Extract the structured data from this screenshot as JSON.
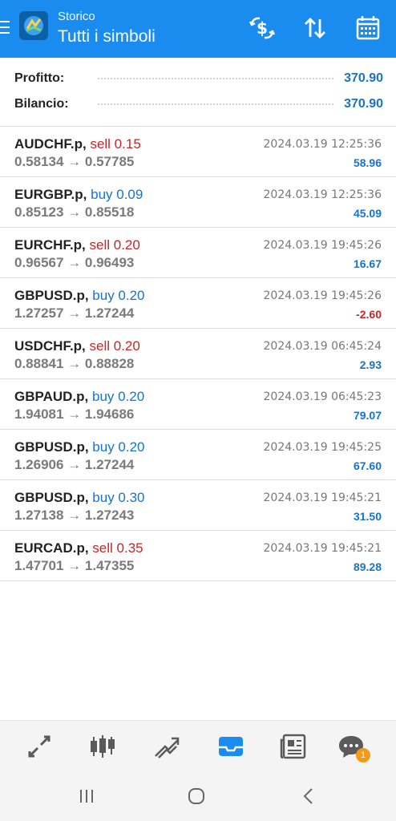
{
  "header": {
    "subtitle": "Storico",
    "title": "Tutti i simboli",
    "icons": [
      "menu-icon",
      "app-logo",
      "dollar-exchange-icon",
      "sort-icon",
      "calendar-icon"
    ]
  },
  "summary": {
    "profit_label": "Profitto:",
    "profit_value": "370.90",
    "balance_label": "Bilancio:",
    "balance_value": "370.90"
  },
  "trades": [
    {
      "symbol": "AUDCHF.p,",
      "side": "sell 0.15",
      "type": "sell",
      "prices": "0.58134 → 0.57785",
      "time": "2024.03.19 12:25:36",
      "profit": "58.96",
      "sign": "pos"
    },
    {
      "symbol": "EURGBP.p,",
      "side": "buy 0.09",
      "type": "buy",
      "prices": "0.85123 → 0.85518",
      "time": "2024.03.19 12:25:36",
      "profit": "45.09",
      "sign": "pos"
    },
    {
      "symbol": "EURCHF.p,",
      "side": "sell 0.20",
      "type": "sell",
      "prices": "0.96567 → 0.96493",
      "time": "2024.03.19 19:45:26",
      "profit": "16.67",
      "sign": "pos"
    },
    {
      "symbol": "GBPUSD.p,",
      "side": "buy 0.20",
      "type": "buy",
      "prices": "1.27257 → 1.27244",
      "time": "2024.03.19 19:45:26",
      "profit": "-2.60",
      "sign": "neg"
    },
    {
      "symbol": "USDCHF.p,",
      "side": "sell 0.20",
      "type": "sell",
      "prices": "0.88841 → 0.88828",
      "time": "2024.03.19 06:45:24",
      "profit": "2.93",
      "sign": "pos"
    },
    {
      "symbol": "GBPAUD.p,",
      "side": "buy 0.20",
      "type": "buy",
      "prices": "1.94081 → 1.94686",
      "time": "2024.03.19 06:45:23",
      "profit": "79.07",
      "sign": "pos"
    },
    {
      "symbol": "GBPUSD.p,",
      "side": "buy 0.20",
      "type": "buy",
      "prices": "1.26906 → 1.27244",
      "time": "2024.03.19 19:45:25",
      "profit": "67.60",
      "sign": "pos"
    },
    {
      "symbol": "GBPUSD.p,",
      "side": "buy 0.30",
      "type": "buy",
      "prices": "1.27138 → 1.27243",
      "time": "2024.03.19 19:45:21",
      "profit": "31.50",
      "sign": "pos"
    },
    {
      "symbol": "EURCAD.p,",
      "side": "sell 0.35",
      "type": "sell",
      "prices": "1.47701 → 1.47355",
      "time": "2024.03.19 19:45:21",
      "profit": "89.28",
      "sign": "pos"
    }
  ],
  "bottom_nav": {
    "items": [
      "quotes-icon",
      "chart-candles-icon",
      "trade-icon",
      "history-inbox-icon",
      "news-icon",
      "chat-icon"
    ],
    "active": "history-inbox-icon",
    "chat_badge": "1"
  },
  "colors": {
    "accent": "#1a8cf0",
    "buy": "#1874c9",
    "sell": "#c0282b"
  }
}
